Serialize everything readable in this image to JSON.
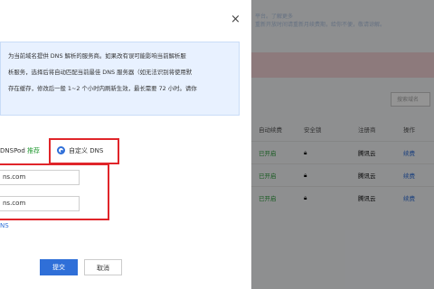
{
  "background": {
    "notice_lines": [
      "平台。了解更多",
      "重新开放时间请重新月续费期，给你不便，敬请谅解。"
    ],
    "search_placeholder": "搜索域名",
    "table_headers": [
      "自动续费",
      "安全锁",
      "注册商",
      "操作"
    ],
    "rows": [
      {
        "auto_renew": "已开启",
        "registrar": "腾讯云",
        "action": "续费"
      },
      {
        "auto_renew": "已开启",
        "registrar": "腾讯云",
        "action": "续费"
      },
      {
        "auto_renew": "已开启",
        "registrar": "腾讯云",
        "action": "续费"
      }
    ]
  },
  "dialog": {
    "close_icon": "×",
    "info_lines": [
      "为当前域名提供 DNS 解析的服务商。如果改有误可能影响当前解析服",
      "析服务，选择后将自动匹配当前最佳 DNS 服务器（如无法识别将使用默",
      "存在缓存，修改后一般 1~2 个小时内刷新生效，最长需要 72 小时。请你"
    ],
    "faint_text": "",
    "option_default": "DNSPod",
    "option_default_tag": "推荐",
    "option_custom": "自定义 DNS",
    "dns_inputs": [
      "ns.com",
      "ns.com"
    ],
    "add_link": "NS",
    "submit_label": "提交",
    "cancel_label": "取消"
  },
  "colors": {
    "accent": "#2f6fd8",
    "highlight_border": "#e0252a",
    "success": "#2a9d39"
  }
}
